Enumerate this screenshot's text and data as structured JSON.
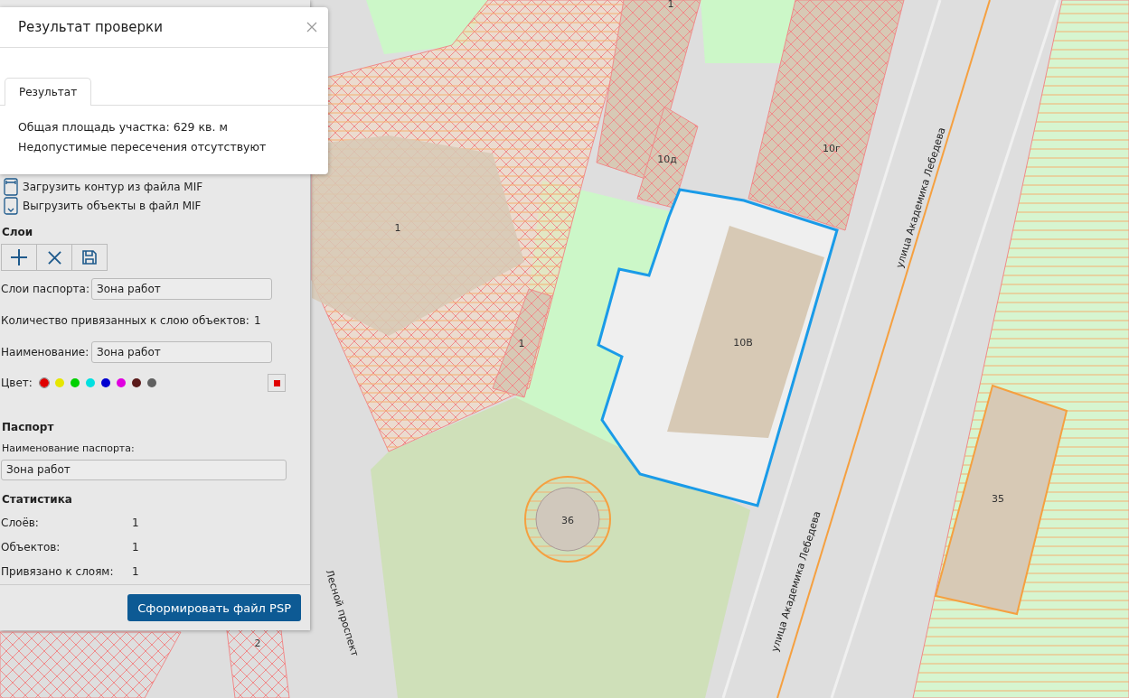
{
  "dialog": {
    "title": "Результат проверки",
    "tabs": [
      {
        "label": "Результат",
        "selected": true
      }
    ],
    "lines": [
      "Общая площадь участка: 629 кв. м",
      "Недопустимые пересечения отсутствуют"
    ]
  },
  "panel": {
    "actions": [
      {
        "kind": "upload",
        "label": "Загрузить контур из файла MIF"
      },
      {
        "kind": "download",
        "label": "Выгрузить объекты в файл MIF"
      }
    ],
    "layers_heading": "Слои",
    "toolbar": [
      {
        "kind": "add"
      },
      {
        "kind": "delete"
      },
      {
        "kind": "save"
      }
    ],
    "passport_layers": {
      "label": "Слои паспорта:",
      "value": "Зона работ"
    },
    "bound_count": {
      "label": "Количество привязанных к слою объектов:",
      "value": "1"
    },
    "layer_name": {
      "label": "Наименование:",
      "value": "Зона работ"
    },
    "color_label": "Цвет:",
    "colors": [
      {
        "color": "#e00000",
        "selected": true
      },
      {
        "color": "#e6e600",
        "selected": false
      },
      {
        "color": "#00d000",
        "selected": false
      },
      {
        "color": "#00e0e0",
        "selected": false
      },
      {
        "color": "#0000d0",
        "selected": false
      },
      {
        "color": "#e000e0",
        "selected": false
      },
      {
        "color": "#5a1a1a",
        "selected": false
      },
      {
        "color": "#606060",
        "selected": false
      }
    ],
    "passport_heading": "Паспорт",
    "passport_name": {
      "label": "Наименование паспорта:",
      "value": "Зона работ"
    },
    "stats_heading": "Статистика",
    "stats": [
      {
        "label": "Слоёв:",
        "value": "1"
      },
      {
        "label": "Объектов:",
        "value": "1"
      },
      {
        "label": "Привязано к слоям:",
        "value": "1"
      }
    ],
    "submit": "Сформировать файл PSP"
  },
  "map": {
    "labels": [
      "1",
      "10г",
      "1",
      "10д",
      "1",
      "10В",
      "36",
      "35",
      "2"
    ],
    "streets": [
      "улица Академика Лебедева",
      "улица Академика Лебедева",
      "Лесной проспект"
    ]
  }
}
